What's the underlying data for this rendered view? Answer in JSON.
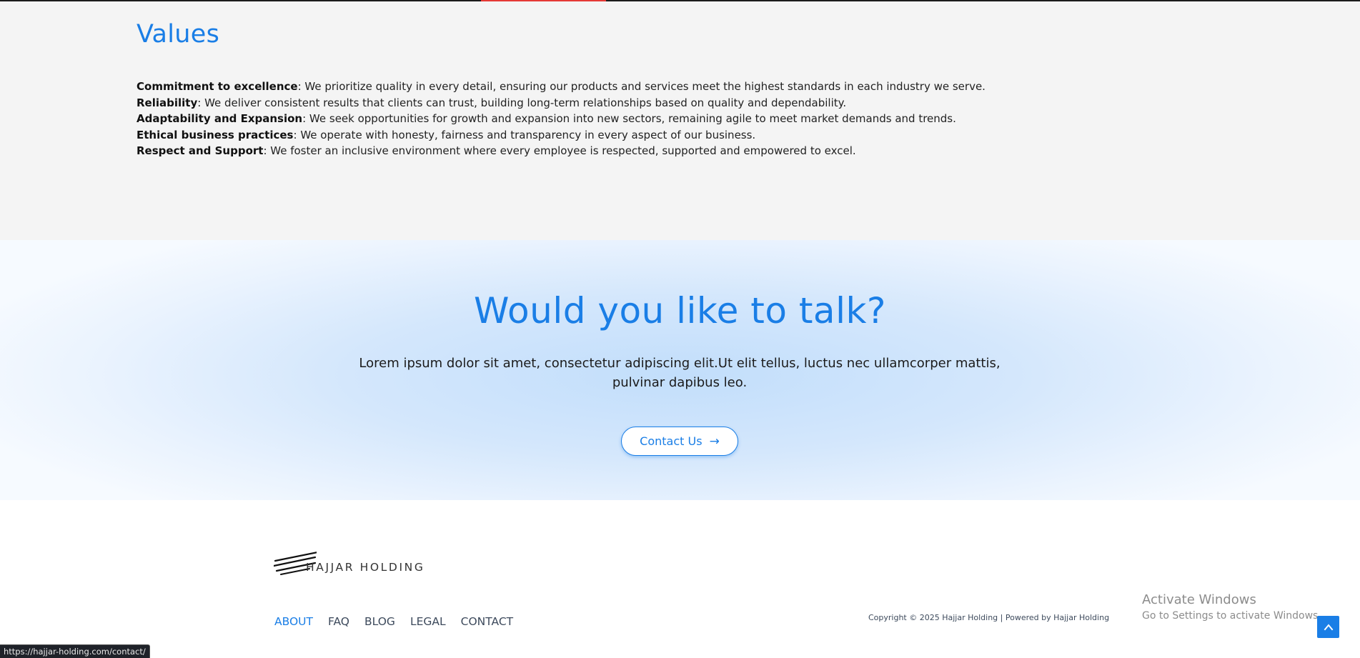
{
  "colors": {
    "accent": "#1a7ee6",
    "top_accent": "#e53935"
  },
  "values": {
    "title": "Values",
    "items": [
      {
        "term": "Commitment to excellence",
        "text": ": We prioritize quality in every detail, ensuring our products and services meet the highest standards in each industry we serve."
      },
      {
        "term": "Reliability",
        "text": ": We deliver consistent results that clients can trust, building long-term relationships based on quality and dependability."
      },
      {
        "term": "Adaptability and Expansion",
        "text": ": We seek opportunities for growth and expansion into new sectors, remaining agile to meet market demands and trends."
      },
      {
        "term": "Ethical business practices",
        "text": ": We operate with honesty, fairness and transparency in every aspect of our business."
      },
      {
        "term": "Respect and Support",
        "text": ": We foster an inclusive environment where every employee is respected, supported and empowered to excel."
      }
    ]
  },
  "talk": {
    "title": "Would you like to talk?",
    "text_line1": "Lorem ipsum dolor sit amet, consectetur adipiscing elit.Ut elit tellus, luctus nec ullamcorper mattis,",
    "text_line2": "pulvinar dapibus leo.",
    "button_label": "Contact Us",
    "button_icon": "→"
  },
  "footer": {
    "logo_text": "HAJJAR HOLDING",
    "nav": [
      {
        "label": "ABOUT",
        "active": true
      },
      {
        "label": "FAQ"
      },
      {
        "label": "BLOG"
      },
      {
        "label": "LEGAL"
      },
      {
        "label": "CONTACT"
      }
    ],
    "copyright": "Copyright © 2025 Hajjar Holding | Powered by Hajjar Holding"
  },
  "windows_watermark": {
    "title": "Activate Windows",
    "subtitle": "Go to Settings to activate Windows."
  },
  "scroll_top_icon": "chevron-up-icon",
  "status_bar_url": "https://hajjar-holding.com/contact/"
}
